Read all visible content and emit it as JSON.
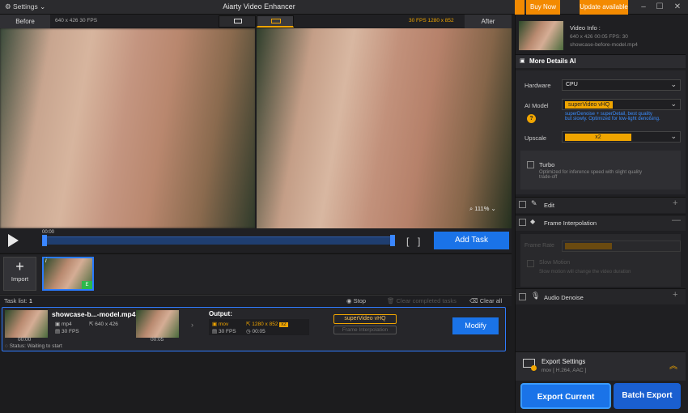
{
  "app": {
    "title": "Aiarty Video Enhancer",
    "settings_label": "Settings",
    "buy_now": "Buy Now",
    "update": "Update available",
    "colors": {
      "accent": "#1a73e8",
      "orange": "#f38a00",
      "highlight": "#f0a500"
    }
  },
  "compare": {
    "before_label": "Before",
    "after_label": "After",
    "before_meta": "640 x 426   30 FPS",
    "after_meta": "30 FPS   1280 x 852",
    "zoom": "111%"
  },
  "transport": {
    "time": "00:00",
    "add_task": "Add Task"
  },
  "import": {
    "label": "Import",
    "badge": "E",
    "italic": "i"
  },
  "tasklist": {
    "label": "Task list:",
    "count": "1",
    "stop": "Stop",
    "clear_completed": "Clear completed tasks",
    "clear_all": "Clear all"
  },
  "task": {
    "filename": "showcase-b...-model.mp4",
    "src_format": "mp4",
    "src_res": "640 x 426",
    "src_fps": "30 FPS",
    "thumb_time": "00:00",
    "thumb_time2": "00:05",
    "output_label": "Output:",
    "out_format": "mov",
    "out_res": "1280 x 852",
    "out_scale": "x2",
    "out_fps": "30 FPS",
    "out_dur": "00:05",
    "model_tag": "superVideo vHQ",
    "fi_tag": "Frame Interpolation",
    "modify": "Modify",
    "status": "Status: Waiting to start"
  },
  "panel": {
    "video_info": "Video Info :",
    "vi_line1": "640 x 426   00:05   FPS: 30",
    "vi_line2": "showcase-before-model.mp4",
    "more_details": "More Details AI",
    "hardware_label": "Hardware",
    "hardware_val": "CPU",
    "ai_model_label": "AI Model",
    "ai_model_val": "superVideo vHQ",
    "ai_model_desc1": "superDenoise + superDetail, best quality",
    "ai_model_desc2": "but slowly. Optimized for low-light denoising.",
    "upscale_label": "Upscale",
    "upscale_val": "x2",
    "turbo_label": "Turbo",
    "turbo_desc1": "Optimized for inference speed with slight quality",
    "turbo_desc2": "trade-off",
    "edit_label": "Edit",
    "fi_label": "Frame Interpolation",
    "frame_rate_label": "Frame Rate",
    "slow_motion_label": "Slow Motion",
    "slow_motion_desc": "Slow motion will change the video duration",
    "audio_label": "Audio Denoise",
    "export_settings": "Export Settings",
    "export_sub": "mov [ H.264, AAC ]",
    "export_current": "Export Current",
    "batch_export": "Batch Export"
  }
}
